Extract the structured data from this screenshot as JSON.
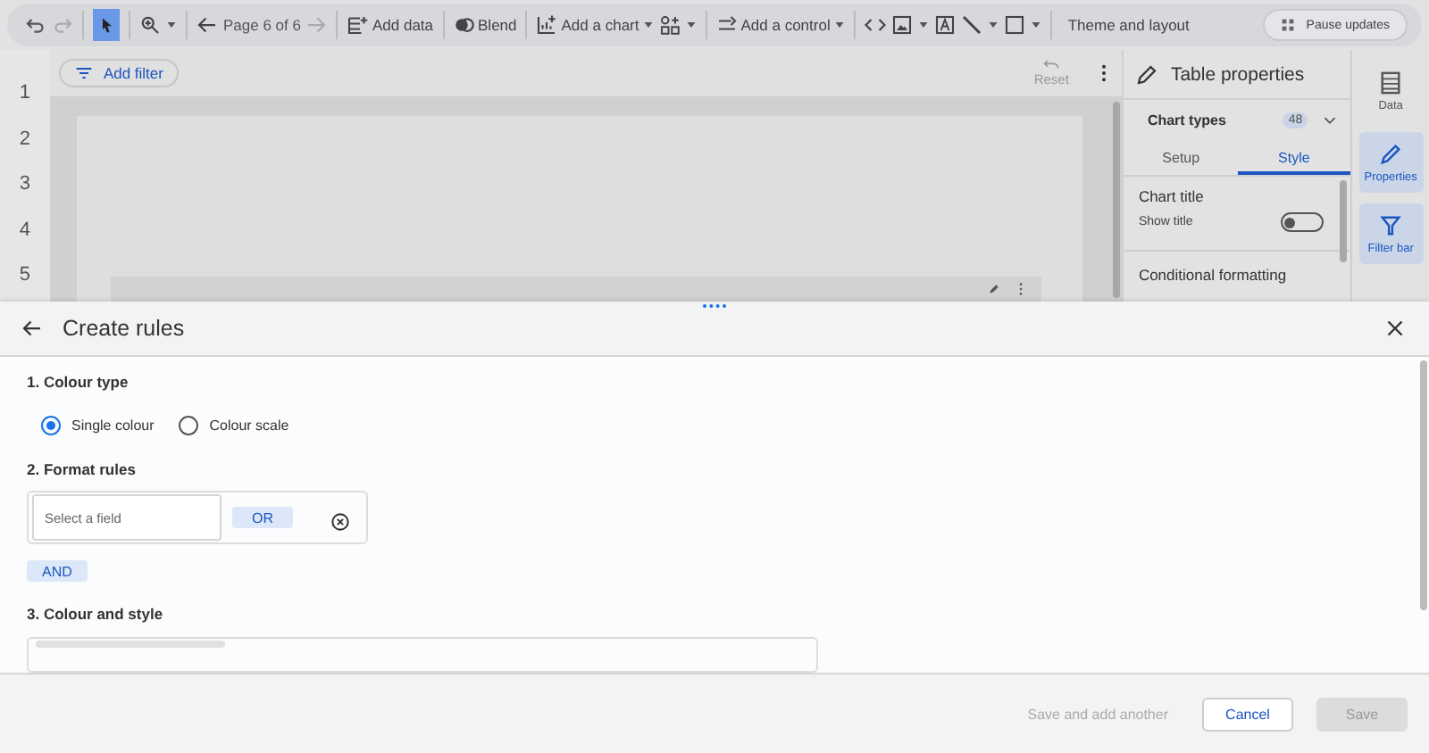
{
  "toolbar": {
    "select_tool": {
      "selected": true
    },
    "page_label": "Page 6 of 6",
    "add_data": "Add data",
    "blend": "Blend",
    "add_chart": "Add a chart",
    "add_control": "Add a control",
    "theme": "Theme and layout",
    "pause": "Pause updates"
  },
  "row_numbers": [
    "1",
    "2",
    "3",
    "4",
    "5"
  ],
  "filter_bar": {
    "add_filter": "Add filter",
    "reset": "Reset"
  },
  "properties": {
    "title": "Table properties",
    "chart_types": "Chart types",
    "chart_count": "48",
    "tabs": [
      {
        "label": "Setup",
        "selected": false
      },
      {
        "label": "Style",
        "selected": true
      }
    ],
    "chart_title": "Chart title",
    "show_title": {
      "label": "Show title",
      "on": false
    },
    "conditional": "Conditional formatting"
  },
  "rail": [
    {
      "label": "Data",
      "selected": false
    },
    {
      "label": "Properties",
      "selected": true
    },
    {
      "label": "Filter bar",
      "selected": true
    }
  ],
  "dialog": {
    "title": "Create rules",
    "colour_type": {
      "heading": "1. Colour type",
      "options": [
        {
          "label": "Single colour",
          "selected": true
        },
        {
          "label": "Colour scale",
          "selected": false
        }
      ]
    },
    "format_rules": {
      "heading": "2. Format rules",
      "field_placeholder": "Select a field",
      "or": "OR",
      "and": "AND"
    },
    "colour_style": {
      "heading": "3. Colour and style"
    },
    "buttons": [
      {
        "label": "Save and add another",
        "kind": "text",
        "disabled": true
      },
      {
        "label": "Cancel",
        "kind": "outlined",
        "disabled": false
      },
      {
        "label": "Save",
        "kind": "filled",
        "disabled": true
      }
    ]
  }
}
